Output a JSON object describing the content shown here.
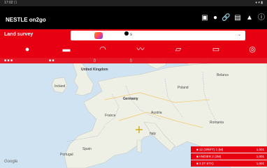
{
  "status_bar": {
    "time": "17:02 ☐",
    "right": "♦ ▾ ▮"
  },
  "header": {
    "app_title": "NESTLE on2go",
    "icons": [
      "document-icon",
      "dot-icon",
      "link-icon",
      "briefcase-icon",
      "person-icon",
      "info-icon"
    ]
  },
  "survey": {
    "label": "Land survey",
    "selected_value": "s",
    "dropdown_chevron": "⌄"
  },
  "toolbar": {
    "tools": [
      {
        "name": "point-tool-icon",
        "glyph": "●"
      },
      {
        "name": "line-tool-icon",
        "glyph": "▬"
      },
      {
        "name": "arc-tool-icon",
        "glyph": "◠"
      },
      {
        "name": "freehand-tool-icon",
        "glyph": "〰"
      },
      {
        "name": "polygon-tool-icon",
        "glyph": "▱"
      },
      {
        "name": "comment-tool-icon",
        "glyph": "▭"
      },
      {
        "name": "target-tool-icon",
        "glyph": "◎"
      }
    ]
  },
  "info_strip": {
    "item1": "■ ■ ■",
    "item2": "■ ■",
    "item3": "▯",
    "item4": "▯"
  },
  "map": {
    "labels": {
      "united_kingdom": "United Kingdom",
      "ireland": "Ireland",
      "germany": "Germany",
      "france": "France",
      "spain": "Spain",
      "italy": "Italy",
      "poland": "Poland",
      "romania": "Romania",
      "belarus": "Belarus",
      "austria": "Austria",
      "portugal": "Portugal"
    },
    "attribution": "Google"
  },
  "legend": {
    "rows": [
      {
        "label": "■ 12 (DRIFT) 1 (M)",
        "value": "1,001"
      },
      {
        "label": "■ ANGIER 2 (2M)",
        "value": "1,001"
      },
      {
        "label": "■ 3 (IT STK)",
        "value": "1,001"
      }
    ]
  },
  "colors": {
    "brand_red": "#e60012",
    "header_black": "#000000",
    "map_water": "#cfe3f2",
    "map_land": "#eef0e6"
  }
}
